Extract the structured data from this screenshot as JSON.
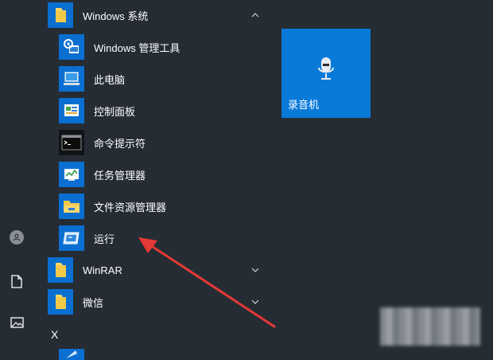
{
  "app_list": {
    "group_windows": {
      "label": "Windows 系统",
      "expanded": true
    },
    "items": [
      {
        "label": "Windows 管理工具",
        "icon": "admin-tools-icon"
      },
      {
        "label": "此电脑",
        "icon": "this-pc-icon"
      },
      {
        "label": "控制面板",
        "icon": "control-panel-icon"
      },
      {
        "label": "命令提示符",
        "icon": "command-prompt-icon"
      },
      {
        "label": "任务管理器",
        "icon": "task-manager-icon"
      },
      {
        "label": "文件资源管理器",
        "icon": "file-explorer-icon"
      },
      {
        "label": "运行",
        "icon": "run-icon"
      }
    ],
    "group_winrar": {
      "label": "WinRAR",
      "expanded": false
    },
    "group_wechat": {
      "label": "微信",
      "expanded": false
    },
    "letter_x": "X"
  },
  "pinned": {
    "tile_label": "录音机",
    "icon": "microphone-icon"
  },
  "colors": {
    "background": "#252c33",
    "tile_blue": "#0a6fd1",
    "arrow_red": "#e53935"
  }
}
